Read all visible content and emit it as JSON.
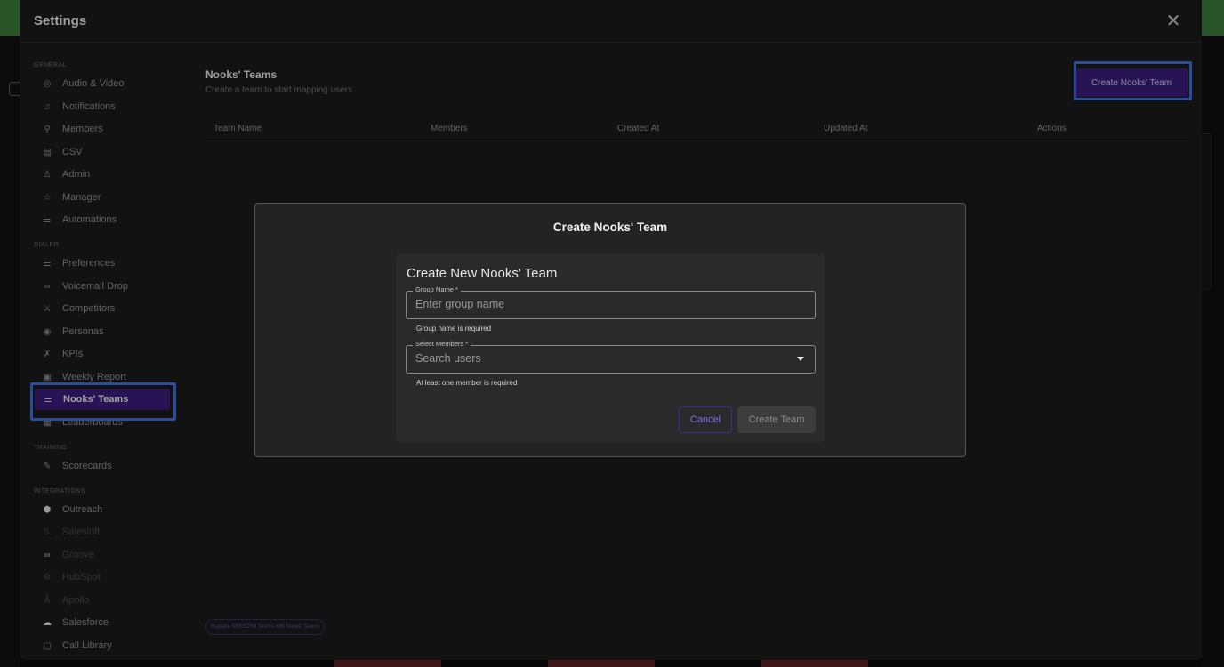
{
  "settings": {
    "title": "Settings"
  },
  "sidebar": {
    "sections": [
      {
        "label": "GENERAL"
      },
      {
        "label": "DIALER"
      },
      {
        "label": "TRAINING"
      },
      {
        "label": "INTEGRATIONS"
      }
    ],
    "items": [
      {
        "label": "Audio & Video",
        "icon": "headset-icon"
      },
      {
        "label": "Notifications",
        "icon": "bell-icon"
      },
      {
        "label": "Members",
        "icon": "person-icon"
      },
      {
        "label": "CSV",
        "icon": "csv-file-icon"
      },
      {
        "label": "Admin",
        "icon": "admin-icon"
      },
      {
        "label": "Manager",
        "icon": "star-icon"
      },
      {
        "label": "Automations",
        "icon": "sliders-icon"
      },
      {
        "label": "Preferences",
        "icon": "sliders-icon"
      },
      {
        "label": "Voicemail Drop",
        "icon": "voicemail-icon"
      },
      {
        "label": "Competitors",
        "icon": "competitors-icon"
      },
      {
        "label": "Personas",
        "icon": "persona-icon"
      },
      {
        "label": "KPIs",
        "icon": "kpi-icon"
      },
      {
        "label": "Weekly Report",
        "icon": "report-icon"
      },
      {
        "label": "Nooks' Teams",
        "icon": "sliders-icon"
      },
      {
        "label": "Leaderboards",
        "icon": "leaderboard-icon"
      },
      {
        "label": "Scorecards",
        "icon": "scorecard-icon"
      },
      {
        "label": "Outreach",
        "icon": "outreach-icon"
      },
      {
        "label": "Salesloft",
        "icon": "salesloft-icon"
      },
      {
        "label": "Groove",
        "icon": "groove-icon"
      },
      {
        "label": "HubSpot",
        "icon": "hubspot-icon"
      },
      {
        "label": "Apollo",
        "icon": "apollo-icon"
      },
      {
        "label": "Salesforce",
        "icon": "salesforce-icon"
      },
      {
        "label": "Call Library",
        "icon": "library-icon"
      }
    ]
  },
  "main": {
    "title": "Nooks' Teams",
    "subtitle": "Create a team to start mapping users",
    "create_button": "Create Nooks' Team",
    "columns": [
      "Team Name",
      "Members",
      "Created At",
      "Updated At",
      "Actions"
    ],
    "replace_link": "Replace SER/CRM Teams with Nooks' Teams"
  },
  "dialog": {
    "title": "Create Nooks' Team",
    "form_title": "Create New Nooks' Team",
    "group_name": {
      "label": "Group Name *",
      "placeholder": "Enter group name",
      "value": "",
      "helper": "Group name is required"
    },
    "members": {
      "label": "Select Members *",
      "placeholder": "Search users",
      "value": "",
      "helper": "At least one member is required"
    },
    "cancel_label": "Cancel",
    "create_label": "Create Team"
  },
  "colors": {
    "accent": "#3a1d7a",
    "highlight": "#3d6ee0"
  }
}
